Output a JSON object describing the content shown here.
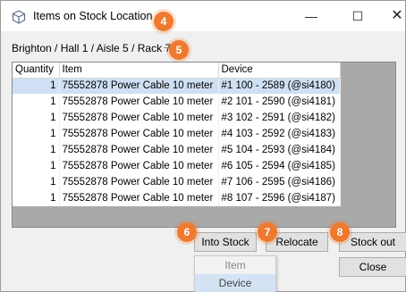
{
  "window": {
    "title": "Items on Stock Location",
    "controls": {
      "minimize": "—",
      "maximize": "☐",
      "close": "✕"
    }
  },
  "breadcrumb": "Brighton / Hall 1 / Aisle 5 / Rack 7",
  "table": {
    "columns": [
      "Quantity",
      "Item",
      "Device"
    ],
    "rows": [
      {
        "qty": "1",
        "item": "75552878 Power Cable 10 meter",
        "device": "#1 100 - 2589 (@si4180)"
      },
      {
        "qty": "1",
        "item": "75552878 Power Cable 10 meter",
        "device": "#2 101 - 2590 (@si4181)"
      },
      {
        "qty": "1",
        "item": "75552878 Power Cable 10 meter",
        "device": "#3 102 - 2591 (@si4182)"
      },
      {
        "qty": "1",
        "item": "75552878 Power Cable 10 meter",
        "device": "#4 103 - 2592 (@si4183)"
      },
      {
        "qty": "1",
        "item": "75552878 Power Cable 10 meter",
        "device": "#5 104 - 2593 (@si4184)"
      },
      {
        "qty": "1",
        "item": "75552878 Power Cable 10 meter",
        "device": "#6 105 - 2594 (@si4185)"
      },
      {
        "qty": "1",
        "item": "75552878 Power Cable 10 meter",
        "device": "#7 106 - 2595 (@si4186)"
      },
      {
        "qty": "1",
        "item": "75552878 Power Cable 10 meter",
        "device": "#8 107 - 2596 (@si4187)"
      }
    ]
  },
  "buttons": {
    "into_stock": "Into Stock",
    "relocate": "Relocate",
    "stock_out": "Stock out",
    "close": "Close"
  },
  "dropdown": {
    "items": [
      "Item",
      "Device"
    ]
  },
  "callouts": [
    "4",
    "5",
    "6",
    "7",
    "8"
  ],
  "colors": {
    "callout": "#ee7a30",
    "selection": "#cfe0f5",
    "grid_background": "#a9a9a9"
  }
}
